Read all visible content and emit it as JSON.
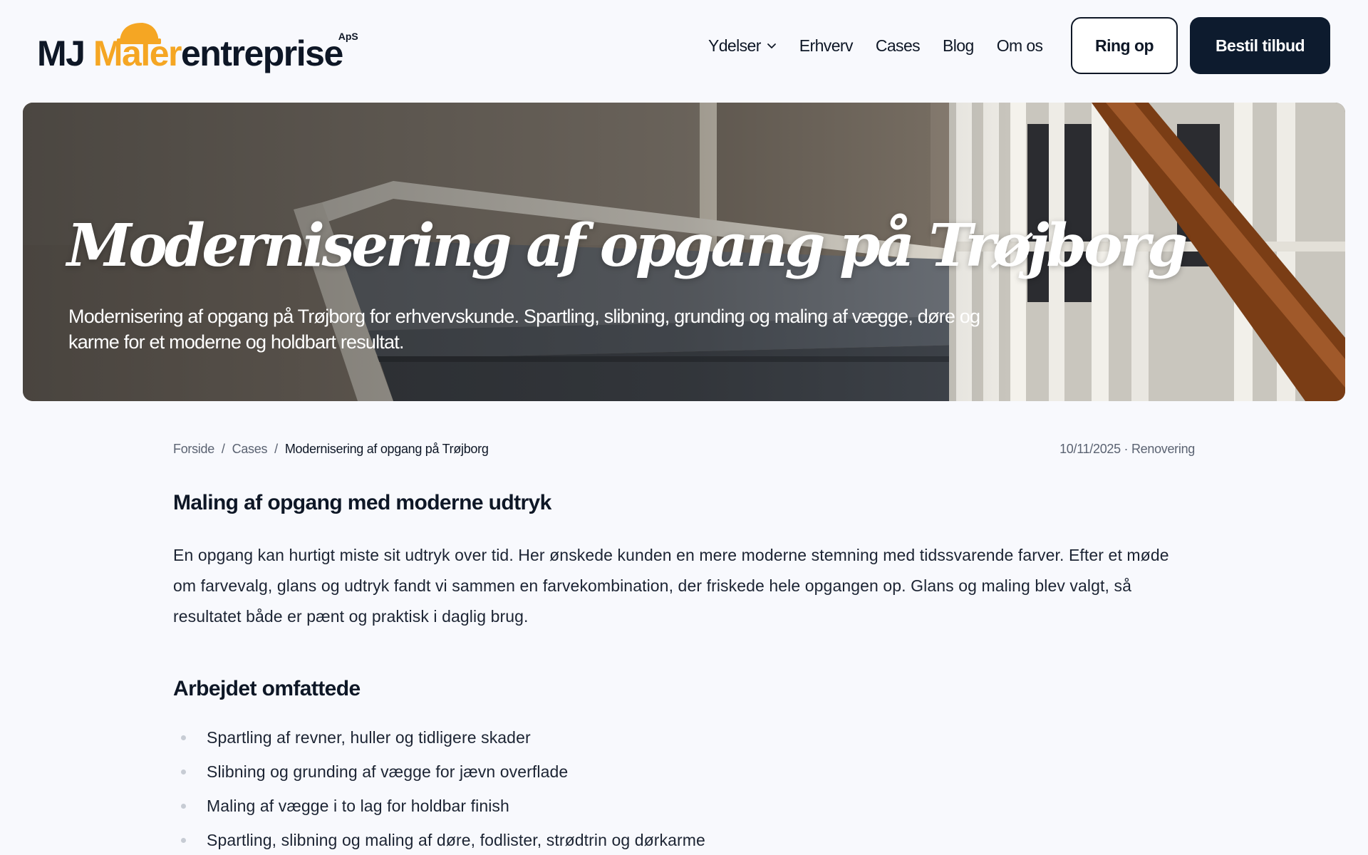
{
  "brand": {
    "prefix": "MJ ",
    "highlight": "Maler",
    "suffix": "entreprise",
    "legal": "ApS",
    "accent_color": "#f5a623",
    "primary_color": "#0d1b2e"
  },
  "nav": {
    "items": [
      {
        "label": "Ydelser",
        "has_dropdown": true
      },
      {
        "label": "Erhverv"
      },
      {
        "label": "Cases"
      },
      {
        "label": "Blog"
      },
      {
        "label": "Om os"
      }
    ],
    "call_label": "Ring op",
    "quote_label": "Bestil tilbud"
  },
  "hero": {
    "title": "Modernisering af opgang på Trøjborg",
    "subtitle": "Modernisering af opgang på Trøjborg for erhvervskunde. Spartling, slibning, grunding og maling af vægge, døre og karme for et moderne og holdbart resultat."
  },
  "breadcrumb": {
    "items": [
      "Forside",
      "Cases"
    ],
    "separator": "/",
    "current": "Modernisering af opgang på Trøjborg"
  },
  "meta": "10/11/2025 · Renovering",
  "article": {
    "heading": "Maling af opgang med moderne udtryk",
    "paragraph": "En opgang kan hurtigt miste sit udtryk over tid. Her ønskede kunden en mere moderne stemning med tidssvarende farver. Efter et møde om farvevalg, glans og udtryk fandt vi sammen en farvekombination, der friskede hele opgangen op. Glans og maling blev valgt, så resultatet både er pænt og praktisk i daglig brug.",
    "subheading": "Arbejdet omfattede",
    "list": [
      "Spartling af revner, huller og tidligere skader",
      "Slibning og grunding af vægge for jævn overflade",
      "Maling af vægge i to lag for holdbar finish",
      "Spartling, slibning og maling af døre, fodlister, strødtrin og dørkarme"
    ]
  }
}
